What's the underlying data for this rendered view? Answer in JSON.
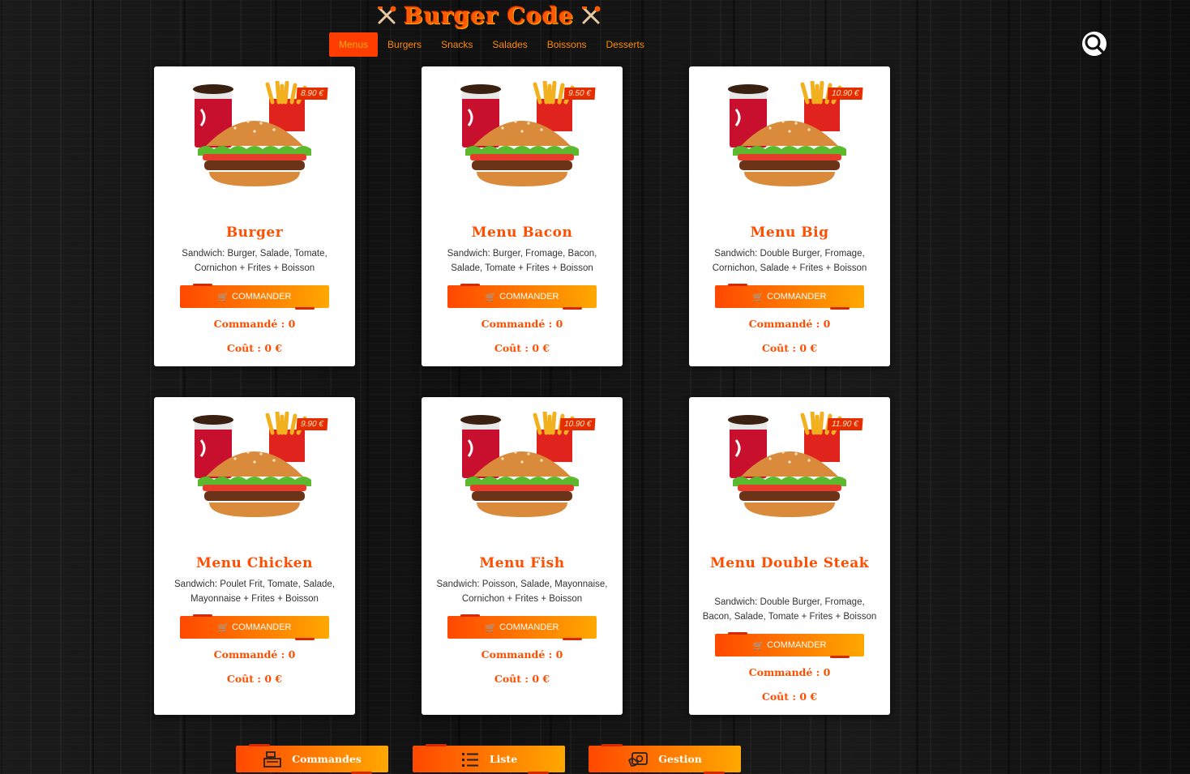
{
  "brand": {
    "title": "Burger Code"
  },
  "nav": {
    "items": [
      "Menus",
      "Burgers",
      "Snacks",
      "Salades",
      "Boissons",
      "Desserts"
    ],
    "active": "Menus"
  },
  "search": {
    "icon": "search-icon"
  },
  "colors": {
    "accent": "#ff4e00",
    "gradient_end": "#ffa800",
    "price_bg": "#e52d00"
  },
  "menus": [
    {
      "title": "Burger",
      "price": "8.90 €",
      "desc": "Sandwich: Burger, Salade, Tomate, Cornichon + Frites + Boisson",
      "order_label": "COMMANDER",
      "ordered": "Commandé : 0",
      "cost": "Coût : 0 €"
    },
    {
      "title": "Menu Bacon",
      "price": "9.50 €",
      "desc": "Sandwich: Burger, Fromage, Bacon, Salade, Tomate + Frites + Boisson",
      "order_label": "COMMANDER",
      "ordered": "Commandé : 0",
      "cost": "Coût : 0 €"
    },
    {
      "title": "Menu Big",
      "price": "10.90 €",
      "desc": "Sandwich: Double Burger, Fromage, Cornichon, Salade + Frites + Boisson",
      "order_label": "COMMANDER",
      "ordered": "Commandé : 0",
      "cost": "Coût : 0 €"
    },
    {
      "title": "Menu Chicken",
      "price": "9.90 €",
      "desc": "Sandwich: Poulet Frit, Tomate, Salade, Mayonnaise + Frites + Boisson",
      "order_label": "COMMANDER",
      "ordered": "Commandé : 0",
      "cost": "Coût : 0 €"
    },
    {
      "title": "Menu Fish",
      "price": "10.90 €",
      "desc": "Sandwich: Poisson, Salade, Mayonnaise, Cornichon + Frites + Boisson",
      "order_label": "COMMANDER",
      "ordered": "Commandé : 0",
      "cost": "Coût : 0 €"
    },
    {
      "title": "Menu Double Steak",
      "price": "11.90 €",
      "desc": "Sandwich: Double Burger, Fromage, Bacon, Salade, Tomate + Frites + Boisson",
      "order_label": "COMMANDER",
      "ordered": "Commandé : 0",
      "cost": "Coût : 0 €"
    }
  ],
  "bottom": {
    "commandes": "Commandes",
    "liste": "Liste",
    "gestion": "Gestion"
  }
}
